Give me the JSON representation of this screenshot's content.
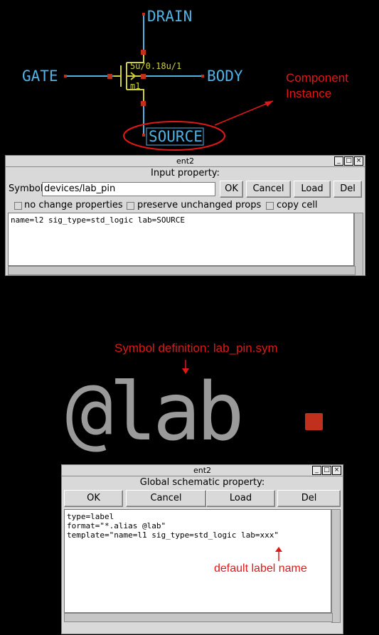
{
  "schematic": {
    "drain": "DRAIN",
    "gate": "GATE",
    "body": "BODY",
    "source": "SOURCE",
    "size": "5u/0.18u/1",
    "inst": "m1"
  },
  "annotations": {
    "component_instance": "Component\nInstance",
    "symbol_def": "Symbol definition: lab_pin.sym",
    "default_label": "default label name"
  },
  "dialog1": {
    "title": "ent2",
    "heading": "Input property:",
    "symbol_label": "Symbol",
    "symbol_value": "devices/lab_pin",
    "ok": "OK",
    "cancel": "Cancel",
    "load": "Load",
    "del": "Del",
    "chk1": "no change properties",
    "chk2": "preserve unchanged props",
    "chk3": "copy cell",
    "text": "name=l2 sig_type=std_logic lab=SOURCE"
  },
  "symbol_text": "@lab",
  "dialog2": {
    "title": "ent2",
    "heading": "Global schematic property:",
    "ok": "OK",
    "cancel": "Cancel",
    "load": "Load",
    "del": "Del",
    "text": "type=label\nformat=\"*.alias @lab\"\ntemplate=\"name=l1 sig_type=std_logic lab=xxx\""
  },
  "colors": {
    "wire": "#4fb3e6",
    "component": "#cfcf3a",
    "pin": "#c0301c",
    "annotation": "#e01818"
  }
}
